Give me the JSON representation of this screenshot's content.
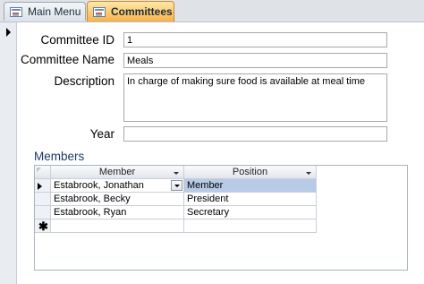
{
  "tabs": [
    {
      "label": "Main Menu",
      "icon": "form-icon",
      "active": false
    },
    {
      "label": "Committees",
      "icon": "form-icon",
      "active": true
    }
  ],
  "form": {
    "committee_id": {
      "label": "Committee ID",
      "value": "1"
    },
    "committee_name": {
      "label": "Committee Name",
      "value": "Meals"
    },
    "description": {
      "label": "Description",
      "value": "In charge of making sure food is available at meal time"
    },
    "year": {
      "label": "Year",
      "value": ""
    }
  },
  "members": {
    "label": "Members",
    "columns": [
      "Member",
      "Position"
    ],
    "rows": [
      {
        "member": "Estabrook, Jonathan",
        "position": "Member"
      },
      {
        "member": "Estabrook, Becky",
        "position": "President"
      },
      {
        "member": "Estabrook, Ryan",
        "position": "Secretary"
      }
    ],
    "new_row_marker": "✱"
  },
  "colors": {
    "active_tab": "#f7b24a",
    "label_blue": "#1f3a66",
    "selection": "#b7cbe6"
  }
}
